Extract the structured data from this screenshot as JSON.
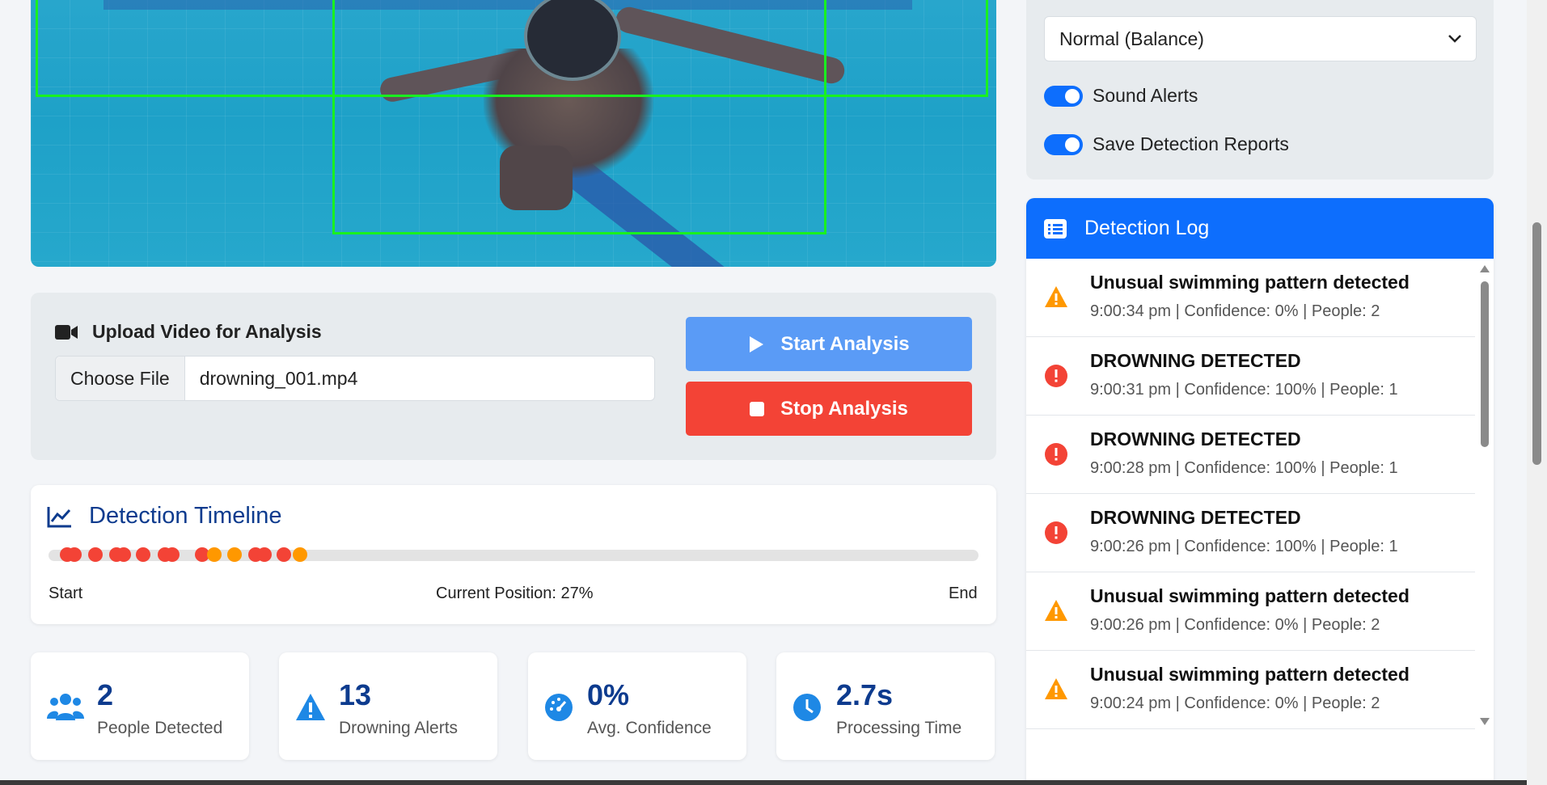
{
  "upload": {
    "title": "Upload Video for Analysis",
    "choose_file_label": "Choose File",
    "file_name": "drowning_001.mp4",
    "start_label": "Start Analysis",
    "stop_label": "Stop Analysis"
  },
  "timeline": {
    "title": "Detection Timeline",
    "start_label": "Start",
    "position_label": "Current Position: 27%",
    "end_label": "End",
    "current_position_percent": 27,
    "markers": [
      {
        "pos": 2.0,
        "color": "#f34336"
      },
      {
        "pos": 2.8,
        "color": "#f34336"
      },
      {
        "pos": 5.0,
        "color": "#f34336"
      },
      {
        "pos": 7.3,
        "color": "#f34336"
      },
      {
        "pos": 8.1,
        "color": "#f34336"
      },
      {
        "pos": 10.2,
        "color": "#f34336"
      },
      {
        "pos": 12.5,
        "color": "#f34336"
      },
      {
        "pos": 13.3,
        "color": "#f34336"
      },
      {
        "pos": 16.5,
        "color": "#f34336"
      },
      {
        "pos": 17.8,
        "color": "#ff9800"
      },
      {
        "pos": 20.0,
        "color": "#ff9800"
      },
      {
        "pos": 22.3,
        "color": "#f34336"
      },
      {
        "pos": 23.2,
        "color": "#f34336"
      },
      {
        "pos": 25.3,
        "color": "#f34336"
      },
      {
        "pos": 27.0,
        "color": "#ff9800"
      }
    ]
  },
  "stats": {
    "people_value": "2",
    "people_label": "People Detected",
    "alerts_value": "13",
    "alerts_label": "Drowning Alerts",
    "confidence_value": "0%",
    "confidence_label": "Avg. Confidence",
    "processing_value": "2.7s",
    "processing_label": "Processing Time"
  },
  "settings": {
    "mode_selected": "Normal (Balance)",
    "sound_alerts_label": "Sound Alerts",
    "save_reports_label": "Save Detection Reports"
  },
  "log": {
    "title": "Detection Log",
    "items": [
      {
        "type": "warning",
        "title": "Unusual swimming pattern detected",
        "meta": "9:00:34 pm | Confidence: 0% | People: 2"
      },
      {
        "type": "danger",
        "title": "DROWNING DETECTED",
        "meta": "9:00:31 pm | Confidence: 100% | People: 1"
      },
      {
        "type": "danger",
        "title": "DROWNING DETECTED",
        "meta": "9:00:28 pm | Confidence: 100% | People: 1"
      },
      {
        "type": "danger",
        "title": "DROWNING DETECTED",
        "meta": "9:00:26 pm | Confidence: 100% | People: 1"
      },
      {
        "type": "warning",
        "title": "Unusual swimming pattern detected",
        "meta": "9:00:26 pm | Confidence: 0% | People: 2"
      },
      {
        "type": "warning",
        "title": "Unusual swimming pattern detected",
        "meta": "9:00:24 pm | Confidence: 0% | People: 2"
      }
    ]
  },
  "colors": {
    "primary": "#0d6efd",
    "danger": "#f34336",
    "warning": "#ff9800",
    "detection_box": "#19f11f",
    "heading": "#0d3b8e"
  }
}
